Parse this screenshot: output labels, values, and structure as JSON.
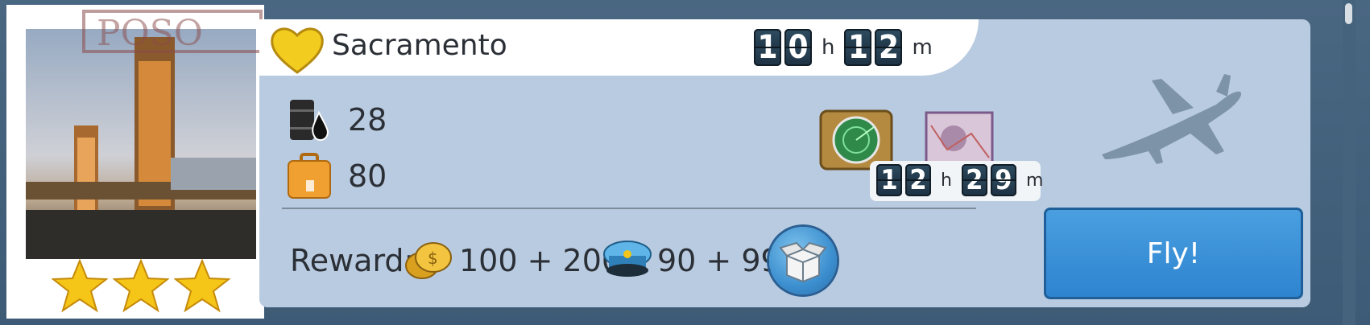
{
  "destination": {
    "name": "Sacramento",
    "favorite_icon": "heart-icon",
    "rating_stars": 3
  },
  "flight_time": {
    "hours_digits": [
      "1",
      "0"
    ],
    "hours_unit": "h",
    "minutes_digits": [
      "1",
      "2"
    ],
    "minutes_unit": "m"
  },
  "resources": {
    "fuel": {
      "icon": "fuel-barrel-icon",
      "value": "28"
    },
    "cargo": {
      "icon": "suitcase-icon",
      "value": "80"
    }
  },
  "upgrade_timer": {
    "icons": [
      "radar-icon",
      "map-icon"
    ],
    "hours_digits": [
      "1",
      "2"
    ],
    "hours_unit": "h",
    "minutes_digits": [
      "2",
      "9"
    ],
    "minutes_unit": "m"
  },
  "reward": {
    "label": "Reward:",
    "coins": "100 + 200",
    "coin_icon": "coins-icon",
    "pilots": "90 + 99",
    "pilot_icon": "pilot-cap-icon",
    "bonus_icon": "gift-box-icon"
  },
  "actions": {
    "fly_label": "Fly!"
  },
  "colors": {
    "card": "#b9cbe0",
    "fly_button": "#2e84cf",
    "heart": "#f2cc1f"
  }
}
